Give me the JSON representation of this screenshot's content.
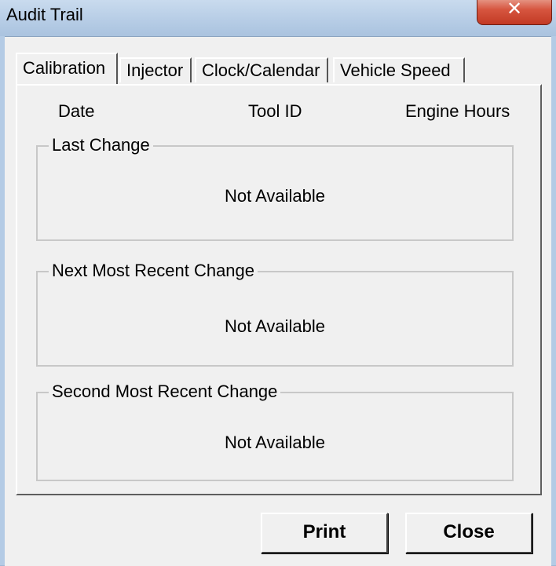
{
  "window": {
    "title": "Audit Trail",
    "close_glyph": "✕"
  },
  "tabs": [
    {
      "label": "Calibration",
      "active": true
    },
    {
      "label": "Injector",
      "active": false
    },
    {
      "label": "Clock/Calendar",
      "active": false
    },
    {
      "label": "Vehicle Speed",
      "active": false
    }
  ],
  "columns": {
    "date": "Date",
    "tool_id": "Tool ID",
    "engine_hours": "Engine Hours"
  },
  "groups": [
    {
      "title": "Last Change",
      "value": "Not Available"
    },
    {
      "title": "Next Most Recent Change",
      "value": "Not Available"
    },
    {
      "title": "Second Most Recent Change",
      "value": "Not Available"
    }
  ],
  "buttons": {
    "print": "Print",
    "close": "Close"
  }
}
